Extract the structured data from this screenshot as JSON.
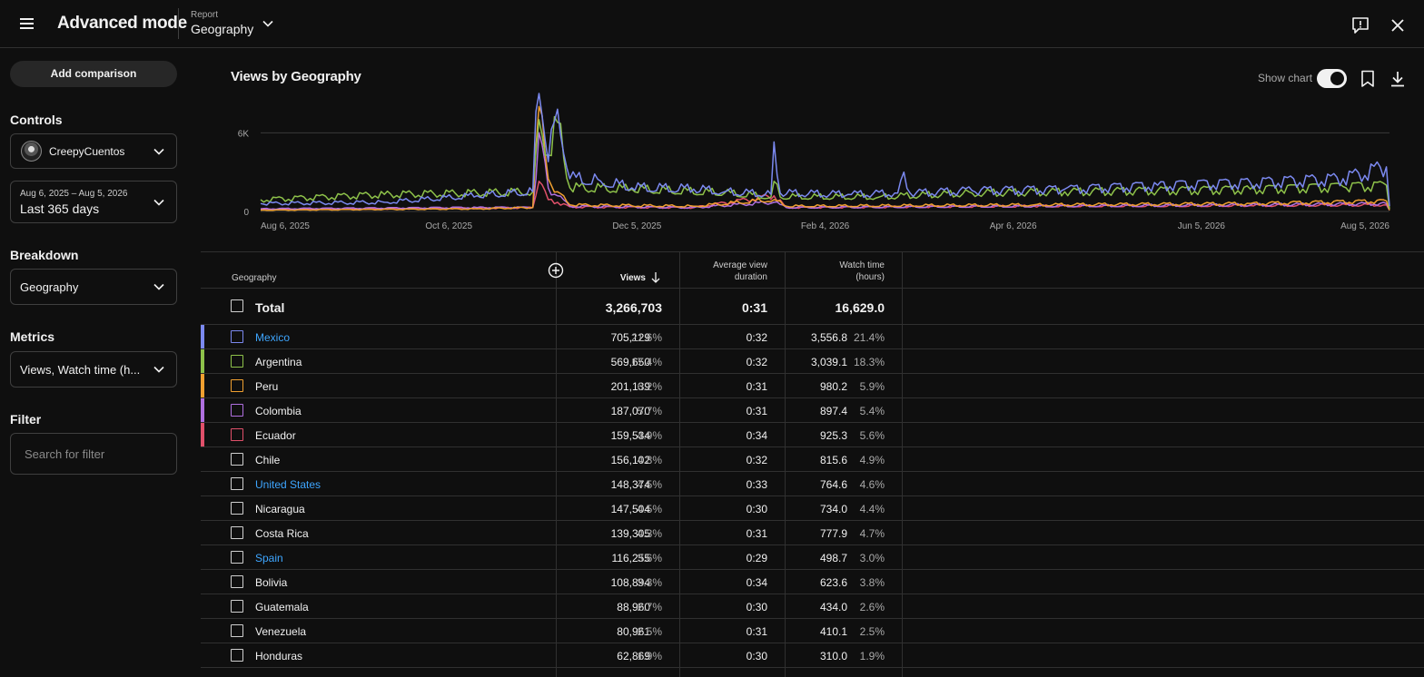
{
  "header": {
    "app_title": "Advanced mode",
    "report_small": "Report",
    "report_name": "Geography"
  },
  "sidebar": {
    "add_comparison": "Add comparison",
    "controls_label": "Controls",
    "channel_name": "CreepyCuentos",
    "date_range_small": "Aug 6, 2025 – Aug 5, 2026",
    "date_range_label": "Last 365 days",
    "breakdown_label": "Breakdown",
    "breakdown_value": "Geography",
    "metrics_label": "Metrics",
    "metrics_value": "Views, Watch time (h...",
    "filter_label": "Filter",
    "filter_placeholder": "Search for filter"
  },
  "chart_header": {
    "title": "Views by Geography",
    "show_chart_label": "Show chart"
  },
  "chart_data": {
    "type": "line",
    "y_ticks": [
      "6K",
      "0"
    ],
    "ylim": [
      0,
      9000
    ],
    "x_ticks": [
      "Aug 6, 2025",
      "Oct 6, 2025",
      "Dec 5, 2025",
      "Feb 4, 2026",
      "Apr 6, 2026",
      "Jun 5, 2026",
      "Aug 5, 2026"
    ],
    "series": [
      {
        "name": "Mexico",
        "color": "#7b89f0",
        "points": [
          [
            0,
            600
          ],
          [
            40,
            700
          ],
          [
            70,
            1200
          ],
          [
            88,
            1500
          ],
          [
            90,
            11000
          ],
          [
            93,
            3800
          ],
          [
            96,
            7800
          ],
          [
            100,
            2500
          ],
          [
            110,
            2300
          ],
          [
            120,
            1800
          ],
          [
            140,
            1700
          ],
          [
            150,
            1500
          ],
          [
            165,
            1300
          ],
          [
            166,
            5300
          ],
          [
            168,
            1400
          ],
          [
            190,
            1300
          ],
          [
            206,
            1400
          ],
          [
            208,
            3000
          ],
          [
            210,
            1400
          ],
          [
            230,
            1600
          ],
          [
            260,
            1700
          ],
          [
            290,
            2000
          ],
          [
            320,
            2200
          ],
          [
            350,
            2500
          ],
          [
            364,
            3400
          ],
          [
            365,
            400
          ]
        ]
      },
      {
        "name": "Argentina",
        "color": "#8ec24a",
        "points": [
          [
            0,
            900
          ],
          [
            40,
            1300
          ],
          [
            70,
            1400
          ],
          [
            88,
            1500
          ],
          [
            90,
            7000
          ],
          [
            93,
            4300
          ],
          [
            96,
            6800
          ],
          [
            100,
            1800
          ],
          [
            120,
            1700
          ],
          [
            150,
            1400
          ],
          [
            165,
            1100
          ],
          [
            166,
            2300
          ],
          [
            168,
            1100
          ],
          [
            200,
            1100
          ],
          [
            230,
            1400
          ],
          [
            260,
            1500
          ],
          [
            290,
            1600
          ],
          [
            320,
            1700
          ],
          [
            350,
            1900
          ],
          [
            364,
            2000
          ],
          [
            365,
            200
          ]
        ]
      },
      {
        "name": "Peru",
        "color": "#f0a030",
        "points": [
          [
            0,
            100
          ],
          [
            70,
            200
          ],
          [
            88,
            300
          ],
          [
            90,
            8000
          ],
          [
            93,
            2500
          ],
          [
            96,
            1500
          ],
          [
            100,
            500
          ],
          [
            140,
            400
          ],
          [
            166,
            900
          ],
          [
            170,
            400
          ],
          [
            250,
            500
          ],
          [
            320,
            600
          ],
          [
            364,
            800
          ],
          [
            365,
            100
          ]
        ]
      },
      {
        "name": "Colombia",
        "color": "#b070e0",
        "points": [
          [
            0,
            200
          ],
          [
            70,
            300
          ],
          [
            88,
            300
          ],
          [
            90,
            6000
          ],
          [
            93,
            1800
          ],
          [
            96,
            1200
          ],
          [
            100,
            400
          ],
          [
            140,
            300
          ],
          [
            166,
            700
          ],
          [
            170,
            300
          ],
          [
            250,
            400
          ],
          [
            320,
            500
          ],
          [
            364,
            600
          ],
          [
            365,
            100
          ]
        ]
      },
      {
        "name": "Ecuador",
        "color": "#e0506a",
        "points": [
          [
            0,
            150
          ],
          [
            70,
            250
          ],
          [
            88,
            300
          ],
          [
            90,
            2300
          ],
          [
            93,
            900
          ],
          [
            96,
            700
          ],
          [
            100,
            350
          ],
          [
            140,
            300
          ],
          [
            166,
            1200
          ],
          [
            170,
            300
          ],
          [
            250,
            400
          ],
          [
            320,
            450
          ],
          [
            364,
            500
          ],
          [
            365,
            100
          ]
        ]
      }
    ]
  },
  "table": {
    "headers": {
      "geography": "Geography",
      "views": "Views",
      "avg_duration_1": "Average view",
      "avg_duration_2": "duration",
      "watch_time_1": "Watch time",
      "watch_time_2": "(hours)"
    },
    "total": {
      "label": "Total",
      "views": "3,266,703",
      "avg_duration": "0:31",
      "watch_time": "16,629.0"
    },
    "rows": [
      {
        "name": "Mexico",
        "link": true,
        "color": "#7b89f0",
        "views": "705,129",
        "views_pct": "21.6%",
        "avg_duration": "0:32",
        "watch_time": "3,556.8",
        "watch_pct": "21.4%"
      },
      {
        "name": "Argentina",
        "link": false,
        "color": "#8ec24a",
        "views": "569,650",
        "views_pct": "17.4%",
        "avg_duration": "0:32",
        "watch_time": "3,039.1",
        "watch_pct": "18.3%"
      },
      {
        "name": "Peru",
        "link": false,
        "color": "#f0a030",
        "views": "201,139",
        "views_pct": "6.2%",
        "avg_duration": "0:31",
        "watch_time": "980.2",
        "watch_pct": "5.9%"
      },
      {
        "name": "Colombia",
        "link": false,
        "color": "#b070e0",
        "views": "187,070",
        "views_pct": "5.7%",
        "avg_duration": "0:31",
        "watch_time": "897.4",
        "watch_pct": "5.4%"
      },
      {
        "name": "Ecuador",
        "link": false,
        "color": "#e0506a",
        "views": "159,534",
        "views_pct": "4.9%",
        "avg_duration": "0:34",
        "watch_time": "925.3",
        "watch_pct": "5.6%"
      },
      {
        "name": "Chile",
        "link": false,
        "color": "",
        "views": "156,102",
        "views_pct": "4.8%",
        "avg_duration": "0:32",
        "watch_time": "815.6",
        "watch_pct": "4.9%"
      },
      {
        "name": "United States",
        "link": true,
        "color": "",
        "views": "148,374",
        "views_pct": "4.5%",
        "avg_duration": "0:33",
        "watch_time": "764.6",
        "watch_pct": "4.6%"
      },
      {
        "name": "Nicaragua",
        "link": false,
        "color": "",
        "views": "147,504",
        "views_pct": "4.5%",
        "avg_duration": "0:30",
        "watch_time": "734.0",
        "watch_pct": "4.4%"
      },
      {
        "name": "Costa Rica",
        "link": false,
        "color": "",
        "views": "139,305",
        "views_pct": "4.3%",
        "avg_duration": "0:31",
        "watch_time": "777.9",
        "watch_pct": "4.7%"
      },
      {
        "name": "Spain",
        "link": true,
        "color": "",
        "views": "116,255",
        "views_pct": "3.6%",
        "avg_duration": "0:29",
        "watch_time": "498.7",
        "watch_pct": "3.0%"
      },
      {
        "name": "Bolivia",
        "link": false,
        "color": "",
        "views": "108,894",
        "views_pct": "3.3%",
        "avg_duration": "0:34",
        "watch_time": "623.6",
        "watch_pct": "3.8%"
      },
      {
        "name": "Guatemala",
        "link": false,
        "color": "",
        "views": "88,960",
        "views_pct": "2.7%",
        "avg_duration": "0:30",
        "watch_time": "434.0",
        "watch_pct": "2.6%"
      },
      {
        "name": "Venezuela",
        "link": false,
        "color": "",
        "views": "80,961",
        "views_pct": "2.5%",
        "avg_duration": "0:31",
        "watch_time": "410.1",
        "watch_pct": "2.5%"
      },
      {
        "name": "Honduras",
        "link": false,
        "color": "",
        "views": "62,869",
        "views_pct": "1.9%",
        "avg_duration": "0:30",
        "watch_time": "310.0",
        "watch_pct": "1.9%"
      }
    ]
  }
}
